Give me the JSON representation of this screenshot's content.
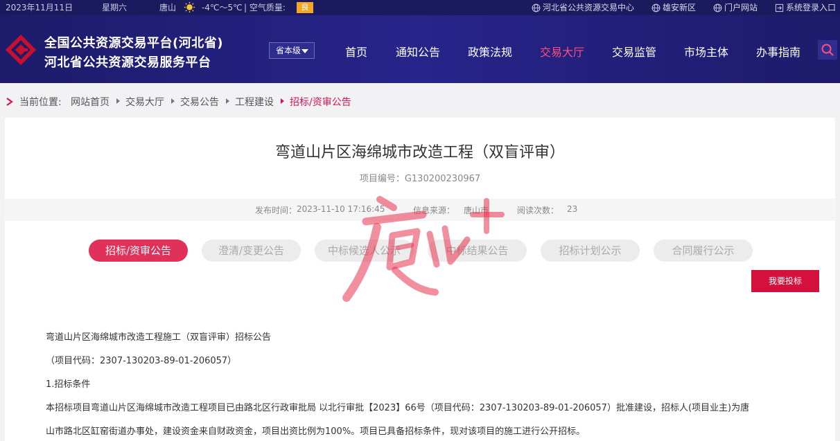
{
  "topbar": {
    "date": "2023年11月11日",
    "weekday": "星期六",
    "city": "唐山",
    "temperature": "-4℃～5℃",
    "air_label": "| 空气质量:",
    "air_value": "良",
    "links": [
      "河北省公共资源交易中心",
      "雄安新区",
      "门户网站",
      "系统登录入口"
    ]
  },
  "header": {
    "brand_line1": "全国公共资源交易平台(河北省)",
    "brand_line2": "河北省公共资源交易服务平台",
    "level_select": "省本级",
    "nav": [
      "首页",
      "通知公告",
      "政策法规",
      "交易大厅",
      "交易监管",
      "市场主体",
      "办事指南"
    ],
    "active_nav": "交易大厅"
  },
  "breadcrumb": {
    "label": "当前位置:",
    "items": [
      "网站首页",
      "交易大厅",
      "交易公告",
      "工程建设",
      "招标/资审公告"
    ]
  },
  "article": {
    "title": "弯道山片区海绵城市改造工程（双盲评审）",
    "project_code": "项目编号：G130200230967",
    "publish_label": "发布时间：",
    "publish_time": "2023-11-10 17:16:45",
    "source_label": "信息来源：",
    "source_value": "唐山市",
    "reads_label": "阅读次数：",
    "reads_value": "23"
  },
  "tabs": [
    "招标/资审公告",
    "澄清/变更公告",
    "中标候选人公示",
    "中标结果公告",
    "招标计划公示",
    "合同履行公示"
  ],
  "active_tab": "招标/资审公告",
  "bid_button": "我要投标",
  "content": {
    "line1": "弯道山片区海绵城市改造工程施工（双盲评审）招标公告",
    "line2": "（项目代码：2307-130203-89-01-206057）",
    "line3": "1.招标条件",
    "line4": "本招标项目弯道山片区海绵城市改造工程项目已由路北区行政审批局 以北行审批【2023】66号（项目代码：2307-130203-89-01-206057）批准建设，招标人(项目业主)为唐",
    "line5": "山市路北区缸窑街道办事处，建设资金来自财政资金，项目出资比例为100%。项目已具备招标条件，现对该项目的施工进行公开招标。"
  },
  "colors": {
    "topbar": "#1b1a5e",
    "header": "#27248a",
    "accent": "#e0315a",
    "nav_active": "#ff4d7d"
  }
}
